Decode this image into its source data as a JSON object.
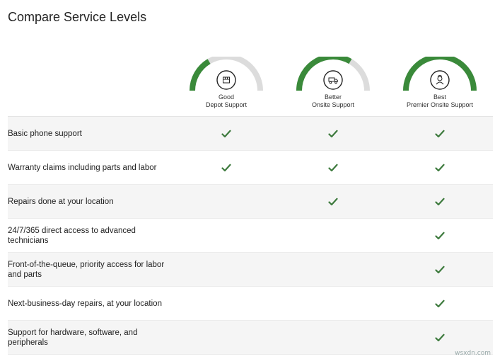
{
  "page": {
    "title": "Compare Service Levels"
  },
  "colors": {
    "accent_green": "#3a8a3a",
    "gauge_gray": "#dcdcdc",
    "check_green": "#3d7a3d"
  },
  "tiers": [
    {
      "level": "Good",
      "name": "Depot Support",
      "icon": "box-icon",
      "gauge_fill": 0.33
    },
    {
      "level": "Better",
      "name": "Onsite Support",
      "icon": "van-icon",
      "gauge_fill": 0.67
    },
    {
      "level": "Best",
      "name": "Premier Onsite Support",
      "icon": "technician-icon",
      "gauge_fill": 1.0
    }
  ],
  "features": [
    {
      "label": "Basic phone support",
      "good": true,
      "better": true,
      "best": true
    },
    {
      "label": "Warranty claims including parts and labor",
      "good": true,
      "better": true,
      "best": true
    },
    {
      "label": "Repairs done at your location",
      "good": false,
      "better": true,
      "best": true
    },
    {
      "label": "24/7/365 direct access to advanced technicians",
      "good": false,
      "better": false,
      "best": true
    },
    {
      "label": "Front-of-the-queue, priority access for labor and parts",
      "good": false,
      "better": false,
      "best": true
    },
    {
      "label": "Next-business-day repairs, at your location",
      "good": false,
      "better": false,
      "best": true
    },
    {
      "label": "Support for hardware, software, and peripherals",
      "good": false,
      "better": false,
      "best": true
    }
  ],
  "watermark": "wsxdn.com"
}
